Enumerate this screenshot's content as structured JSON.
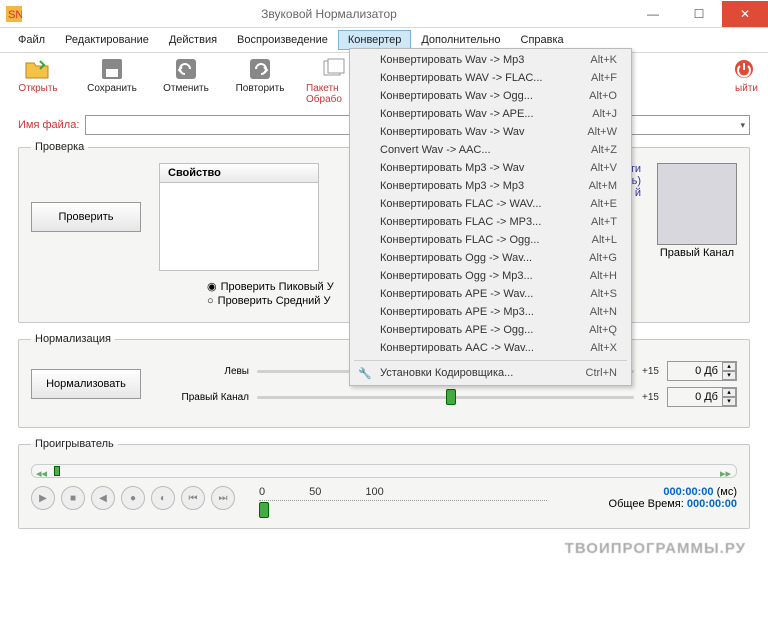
{
  "window": {
    "title": "Звуковой Нормализатор"
  },
  "menu": {
    "file": "Файл",
    "edit": "Редактирование",
    "actions": "Действия",
    "playback": "Воспроизведение",
    "converter": "Конвертер",
    "extra": "Дополнительно",
    "help": "Справка"
  },
  "dropdown": {
    "items": [
      {
        "label": "Конвертировать Wav -> Mp3",
        "shortcut": "Alt+K"
      },
      {
        "label": "Конвертировать WAV -> FLAC...",
        "shortcut": "Alt+F"
      },
      {
        "label": "Конвертировать Wav -> Ogg...",
        "shortcut": "Alt+O"
      },
      {
        "label": "Конвертировать Wav -> APE...",
        "shortcut": "Alt+J"
      },
      {
        "label": "Конвертировать Wav -> Wav",
        "shortcut": "Alt+W"
      },
      {
        "label": "Convert Wav -> AAC...",
        "shortcut": "Alt+Z"
      },
      {
        "label": "Конвертировать Mp3 -> Wav",
        "shortcut": "Alt+V"
      },
      {
        "label": "Конвертировать Mp3 -> Mp3",
        "shortcut": "Alt+M"
      },
      {
        "label": "Конвертировать FLAC -> WAV...",
        "shortcut": "Alt+E"
      },
      {
        "label": "Конвертировать FLAC -> MP3...",
        "shortcut": "Alt+T"
      },
      {
        "label": "Конвертировать FLAC -> Ogg...",
        "shortcut": "Alt+L"
      },
      {
        "label": "Конвертировать Ogg -> Wav...",
        "shortcut": "Alt+G"
      },
      {
        "label": "Конвертировать Ogg -> Mp3...",
        "shortcut": "Alt+H"
      },
      {
        "label": "Конвертировать APE -> Wav...",
        "shortcut": "Alt+S"
      },
      {
        "label": "Конвертировать APE -> Mp3...",
        "shortcut": "Alt+N"
      },
      {
        "label": "Конвертировать APE -> Ogg...",
        "shortcut": "Alt+Q"
      },
      {
        "label": "Конвертировать AAC -> Wav...",
        "shortcut": "Alt+X"
      }
    ],
    "settings": {
      "label": "Установки Кодировщика...",
      "shortcut": "Ctrl+N"
    }
  },
  "toolbar": {
    "open": "Открыть",
    "save": "Сохранить",
    "undo": "Отменить",
    "redo": "Повторить",
    "batch": "Пакетн Обрабо",
    "exit": "ыйти"
  },
  "filename_label": "Имя файла:",
  "check": {
    "legend": "Проверка",
    "property": "Свойство",
    "button": "Проверить",
    "radio_peak": "Проверить Пиковый У",
    "radio_avg": "Проверить Средний У",
    "right_hint1": "сти",
    "right_hint2": "ень)",
    "right_hint3": "й",
    "right_channel": "Правый Канал"
  },
  "normalize": {
    "legend": "Нормализация",
    "button": "Нормализовать",
    "left_label": "Левы",
    "right_label": "Правый Канал",
    "plus15": "+15",
    "db": "0 Дб"
  },
  "player": {
    "legend": "Проигрыватель",
    "ticks": [
      "0",
      "50",
      "100"
    ],
    "time": "000:00:00",
    "time_unit": "(мс)",
    "total_label": "Общее Время:",
    "total": "000:00:00"
  },
  "watermark": "ТВОИПРОГРАММЫ.РУ"
}
